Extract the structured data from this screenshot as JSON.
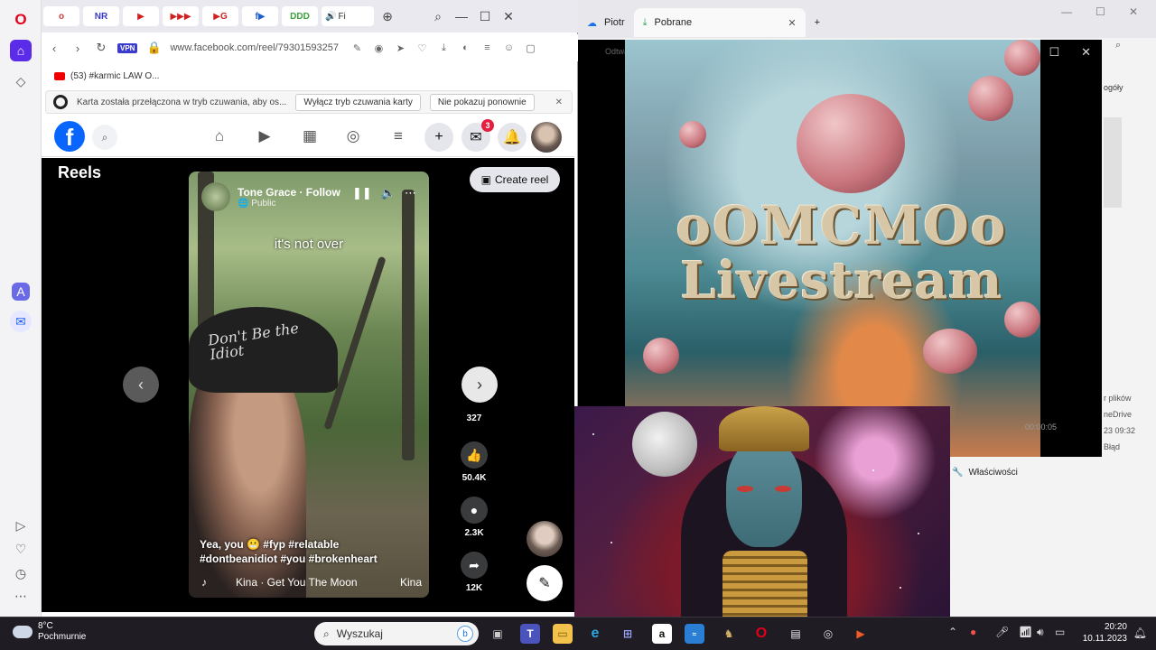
{
  "opera": {
    "tabs": [
      {
        "label": "o",
        "color": "#d03a3a"
      },
      {
        "label": "NR",
        "color": "#3a3ad0"
      },
      {
        "label": "▶",
        "color": "#d02020"
      },
      {
        "label": "▶▶▶",
        "color": "#d02020"
      },
      {
        "label": "▶G",
        "color": "#d02020"
      },
      {
        "label": "f▶",
        "color": "#1f5fd0"
      },
      {
        "label": "DDD",
        "color": "#3aa03a"
      }
    ],
    "active_tab": "Fi",
    "url": "www.facebook.com/reel/79301593257",
    "vpn_label": "VPN",
    "bookmark": "(53) #karmic LAW O...",
    "notice": {
      "text": "Karta została przełączona w tryb czuwania, aby os...",
      "button1": "Wyłącz tryb czuwania karty",
      "button2": "Nie pokazuj ponownie"
    }
  },
  "facebook": {
    "logo": "f",
    "messenger_badge": "3",
    "reels_title": "Reels",
    "create_reel": "Create reel",
    "video": {
      "author": "Tone Grace · Follow",
      "visibility": "Public",
      "caption_top": "it's not over",
      "cap_text": "Don't Be the Idiot",
      "description": "Yea, you 😬 #fyp #relatable #dontbeanidiot #you #brokenheart",
      "music": "Kina · Get You The Moon",
      "music_tail": "Kina"
    },
    "actions": [
      {
        "name": "reactions",
        "count": "327",
        "icon": "♥"
      },
      {
        "name": "like",
        "count": "50.4K",
        "icon": "👍"
      },
      {
        "name": "comment",
        "count": "2.3K",
        "icon": "💬"
      },
      {
        "name": "share",
        "count": "12K",
        "icon": "➦"
      }
    ]
  },
  "explorer": {
    "tab1": "Piotr",
    "tab2": "Pobrane",
    "side_label": "ogóły",
    "right_items": [
      "r plików",
      "neDrive",
      "23 09:32",
      "Błąd"
    ],
    "properties": "Właściwości"
  },
  "player": {
    "title": "Odtwarzacz multimedialny",
    "art_line1": "oOMCMOo",
    "art_line2": "Livestream",
    "time": "00:00:05"
  },
  "taskbar": {
    "temp": "8°C",
    "weather": "Pochmurnie",
    "search_placeholder": "Wyszukaj",
    "time": "20:20",
    "date": "10.11.2023"
  }
}
